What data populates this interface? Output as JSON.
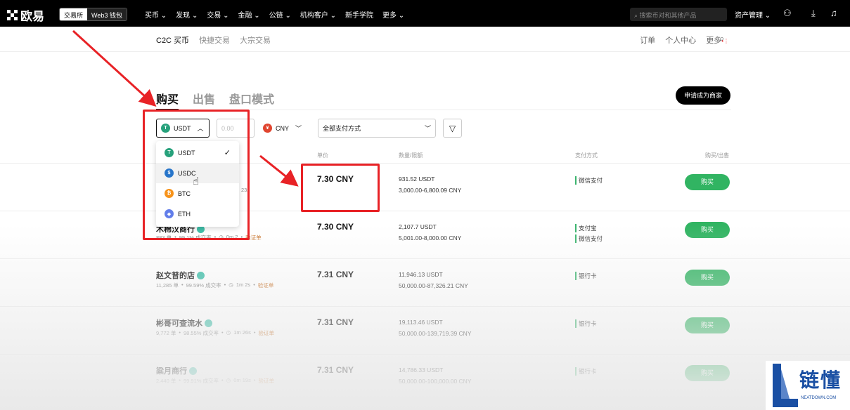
{
  "topbar": {
    "logo": "欧易",
    "mode_exchange": "交易所",
    "mode_wallet": "Web3 钱包",
    "nav": [
      "买币 ⌄",
      "发现 ⌄",
      "交易 ⌄",
      "金融 ⌄",
      "公链 ⌄",
      "机构客户 ⌄",
      "新手学院",
      "更多 ⌄"
    ],
    "search_placeholder": "搜索币对和其他产品",
    "asset": "资产管理 ⌄"
  },
  "subnav": {
    "tabs": [
      "C2C 买币",
      "快捷交易",
      "大宗交易"
    ],
    "right": [
      "订单",
      "个人中心",
      "更多"
    ]
  },
  "tabs": [
    "购买",
    "出售",
    "盘口模式"
  ],
  "apply_button": "申请成为商家",
  "filters": {
    "coin": "USDT",
    "amount_placeholder": "0.00",
    "fiat": "CNY",
    "payment": "全部支付方式"
  },
  "columns": {
    "price": "单价",
    "quantity": "数量/限额",
    "payment": "支付方式",
    "action": "购买/出售"
  },
  "dropdown": [
    {
      "label": "USDT",
      "color": "#26a17b",
      "glyph": "T",
      "selected": true
    },
    {
      "label": "USDC",
      "color": "#2775ca",
      "glyph": "$",
      "selected": false
    },
    {
      "label": "BTC",
      "color": "#f7931a",
      "glyph": "₿",
      "selected": false
    },
    {
      "label": "ETH",
      "color": "#627eea",
      "glyph": "◆",
      "selected": false
    }
  ],
  "rows": [
    {
      "name": "",
      "stats": [
        "",
        "",
        "",
        "23s",
        ""
      ],
      "price": "7.30 CNY",
      "qty": "931.52 USDT",
      "limit": "3,000.00-6,800.09 CNY",
      "pay": [
        "微信支付"
      ],
      "action": "购买"
    },
    {
      "name": "木棉汉商行",
      "stats": [
        "883 单",
        "99.1% 成交率",
        "0m 2",
        "验证单"
      ],
      "price": "7.30 CNY",
      "qty": "2,107.7 USDT",
      "limit": "5,001.00-8,000.00 CNY",
      "pay": [
        "支付宝",
        "微信支付"
      ],
      "action": "购买"
    },
    {
      "name": "赵文普的店",
      "stats": [
        "11,285 单",
        "99.59% 成交率",
        "1m 2s",
        "验证单"
      ],
      "price": "7.31 CNY",
      "qty": "11,946.13 USDT",
      "limit": "50,000.00-87,326.21 CNY",
      "pay": [
        "银行卡"
      ],
      "action": "购买"
    },
    {
      "name": "彬哥可查流水",
      "stats": [
        "9,772 单",
        "98.55% 成交率",
        "1m 26s",
        "验证单"
      ],
      "price": "7.31 CNY",
      "qty": "19,113.46 USDT",
      "limit": "50,000.00-139,719.39 CNY",
      "pay": [
        "银行卡"
      ],
      "action": "购买"
    },
    {
      "name": "粱月商行",
      "stats": [
        "2,440 单",
        "99.91% 成交率",
        "0m 19s",
        "验证单"
      ],
      "price": "7.31 CNY",
      "qty": "14,786.33 USDT",
      "limit": "50,000.00-100,000.00 CNY",
      "pay": [
        "银行卡"
      ],
      "action": "购买"
    }
  ],
  "watermark": {
    "main": "链懂",
    "sub": "NEATDOWN.COM"
  },
  "colors": {
    "buy": "#31b462",
    "annotation": "#e82226"
  }
}
